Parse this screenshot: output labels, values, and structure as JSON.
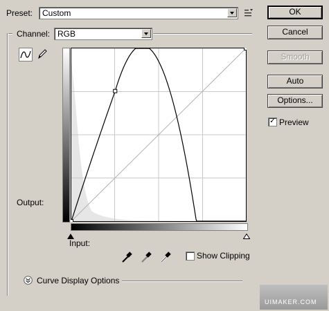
{
  "preset": {
    "label": "Preset:",
    "value": "Custom"
  },
  "channel": {
    "label": "Channel:",
    "value": "RGB"
  },
  "buttons": {
    "ok": "OK",
    "cancel": "Cancel",
    "smooth": "Smooth",
    "auto": "Auto",
    "options": "Options..."
  },
  "preview": {
    "label": "Preview",
    "checked": true
  },
  "graph": {
    "output_label": "Output:",
    "input_label": "Input:"
  },
  "show_clipping": {
    "label": "Show Clipping",
    "checked": false
  },
  "curve_display": {
    "label": "Curve Display Options"
  },
  "curve": {
    "points": [
      [
        0,
        0
      ],
      [
        64,
        192
      ],
      [
        255,
        255
      ]
    ]
  },
  "watermark": {
    "text": "UIMAKER.COM"
  }
}
